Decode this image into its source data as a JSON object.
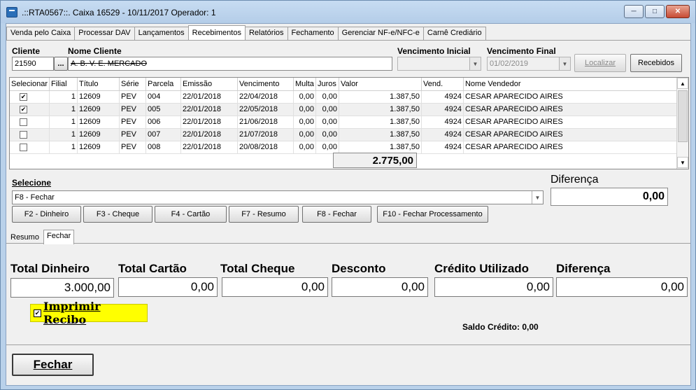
{
  "window": {
    "title": ".::RTA0567::. Caixa 16529 - 10/11/2017 Operador: 1"
  },
  "top_tabs": [
    {
      "label": "Venda pelo Caixa"
    },
    {
      "label": "Processar DAV"
    },
    {
      "label": "Lançamentos"
    },
    {
      "label": "Recebimentos"
    },
    {
      "label": "Relatórios"
    },
    {
      "label": "Fechamento"
    },
    {
      "label": "Gerenciar NF-e/NFC-e"
    },
    {
      "label": "Carnê Crediário"
    }
  ],
  "filters": {
    "cliente_label": "Cliente",
    "cliente_value": "21590",
    "nome_cliente_label": "Nome Cliente",
    "nome_cliente_value": "A. B. V. E. MERCADO",
    "venc_inicial_label": "Vencimento Inicial",
    "venc_inicial_value": "",
    "venc_final_label": "Vencimento Final",
    "venc_final_value": "01/02/2019",
    "localizar_label": "Localizar",
    "recebidos_label": "Recebidos",
    "ellipsis": "..."
  },
  "grid": {
    "headers": [
      "Selecionar",
      "Filial",
      "Título",
      "Série",
      "Parcela",
      "Emissão",
      "Vencimento",
      "Multa",
      "Juros",
      "Valor",
      "Vend.",
      "Nome Vendedor"
    ],
    "rows": [
      {
        "checked": true,
        "filial": "1",
        "titulo": "12609",
        "serie": "PEV",
        "parcela": "004",
        "emissao": "22/01/2018",
        "vencimento": "22/04/2018",
        "multa": "0,00",
        "juros": "0,00",
        "valor": "1.387,50",
        "vend": "4924",
        "vendedor": "CESAR APARECIDO AIRES"
      },
      {
        "checked": true,
        "filial": "1",
        "titulo": "12609",
        "serie": "PEV",
        "parcela": "005",
        "emissao": "22/01/2018",
        "vencimento": "22/05/2018",
        "multa": "0,00",
        "juros": "0,00",
        "valor": "1.387,50",
        "vend": "4924",
        "vendedor": "CESAR APARECIDO AIRES"
      },
      {
        "checked": false,
        "filial": "1",
        "titulo": "12609",
        "serie": "PEV",
        "parcela": "006",
        "emissao": "22/01/2018",
        "vencimento": "21/06/2018",
        "multa": "0,00",
        "juros": "0,00",
        "valor": "1.387,50",
        "vend": "4924",
        "vendedor": "CESAR APARECIDO AIRES"
      },
      {
        "checked": false,
        "filial": "1",
        "titulo": "12609",
        "serie": "PEV",
        "parcela": "007",
        "emissao": "22/01/2018",
        "vencimento": "21/07/2018",
        "multa": "0,00",
        "juros": "0,00",
        "valor": "1.387,50",
        "vend": "4924",
        "vendedor": "CESAR APARECIDO AIRES"
      },
      {
        "checked": false,
        "filial": "1",
        "titulo": "12609",
        "serie": "PEV",
        "parcela": "008",
        "emissao": "22/01/2018",
        "vencimento": "20/08/2018",
        "multa": "0,00",
        "juros": "0,00",
        "valor": "1.387,50",
        "vend": "4924",
        "vendedor": "CESAR APARECIDO AIRES"
      }
    ],
    "total": "2.775,00"
  },
  "selecione": {
    "label": "Selecione",
    "value": "F8 - Fechar",
    "diferenca_label": "Diferença",
    "diferenca_value": "0,00"
  },
  "actions": [
    {
      "label": "F2 - Dinheiro"
    },
    {
      "label": "F3 - Cheque"
    },
    {
      "label": "F4 - Cartão"
    },
    {
      "label": "F7 - Resumo"
    },
    {
      "label": "F8 - Fechar"
    },
    {
      "label": "F10 - Fechar Processamento"
    }
  ],
  "bottom_tabs": {
    "resumo": "Resumo",
    "fechar": "Fechar"
  },
  "totals": {
    "dinheiro_label": "Total Dinheiro",
    "dinheiro_value": "3.000,00",
    "cartao_label": "Total Cartão",
    "cartao_value": "0,00",
    "cheque_label": "Total Cheque",
    "cheque_value": "0,00",
    "desconto_label": "Desconto",
    "desconto_value": "0,00",
    "credito_label": "Crédito Utilizado",
    "credito_value": "0,00",
    "diferenca_label": "Diferença",
    "diferenca_value": "0,00"
  },
  "imprimir_recibo": {
    "label": "Imprimir Recibo",
    "checked": true,
    "highlight": "#ffff00"
  },
  "saldo_credito": "Saldo Crédito: 0,00",
  "footer": {
    "fechar_label": "Fechar"
  }
}
